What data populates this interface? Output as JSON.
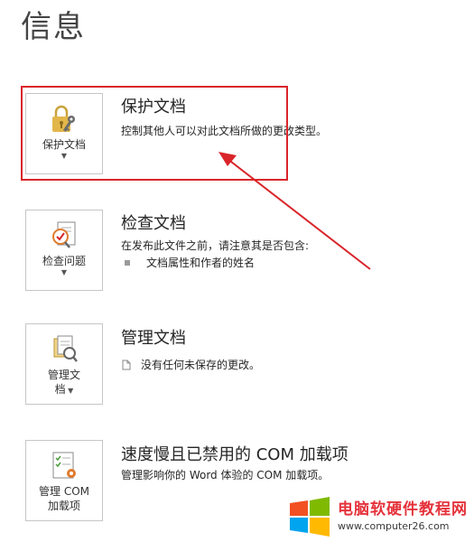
{
  "page": {
    "title": "信息"
  },
  "sections": {
    "protect": {
      "tile_label": "保护文档",
      "title": "保护文档",
      "description": "控制其他人可以对此文档所做的更改类型。"
    },
    "inspect": {
      "tile_label": "检查问题",
      "title": "检查文档",
      "description": "在发布此文件之前，请注意其是否包含:",
      "bullet": "文档属性和作者的姓名"
    },
    "manage": {
      "tile_label_line1": "管理文",
      "tile_label_line2": "档",
      "title": "管理文档",
      "description": "没有任何未保存的更改。"
    },
    "com": {
      "tile_label_line1": "管理 COM",
      "tile_label_line2": "加载项",
      "title": "速度慢且已禁用的 COM 加载项",
      "description": "管理影响你的 Word 体验的 COM 加载项。"
    }
  },
  "annotation": {
    "color": "#d9252a"
  },
  "watermark": {
    "site_name": "电脑软硬件教程网",
    "url": "www.computer26.com",
    "logo_colors": [
      "#f25022",
      "#7fba00",
      "#00a4ef",
      "#ffb900"
    ]
  }
}
